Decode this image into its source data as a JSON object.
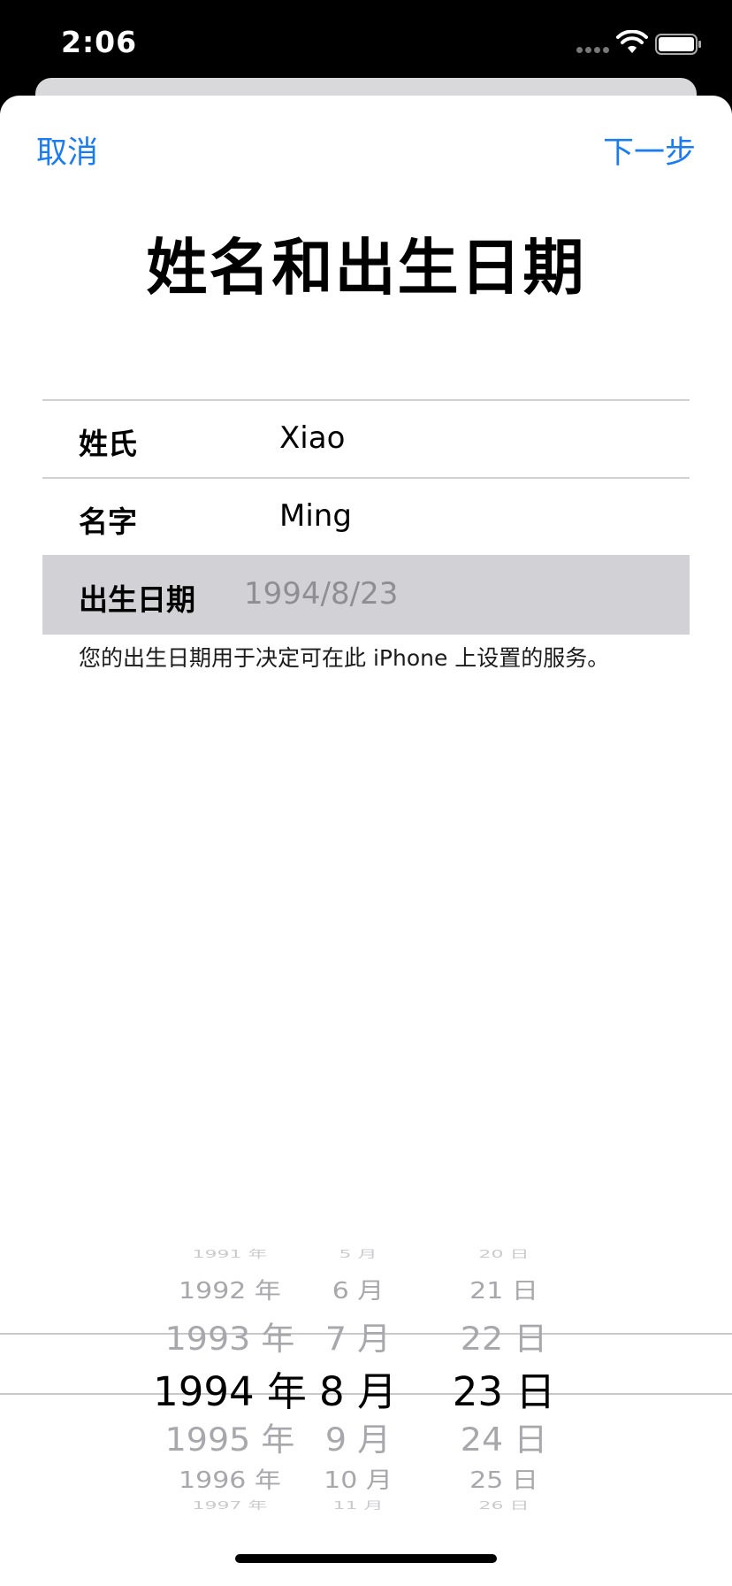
{
  "status_bar": {
    "time": "2:06"
  },
  "nav": {
    "cancel_label": "取消",
    "next_label": "下一步"
  },
  "title": "姓名和出生日期",
  "form": {
    "rows": [
      {
        "label": "姓氏",
        "value": "Xiao"
      },
      {
        "label": "名字",
        "value": "Ming"
      },
      {
        "label": "出生日期",
        "value": "1994/8/23"
      }
    ],
    "footnote": "您的出生日期用于决定可在此 iPhone 上设置的服务。"
  },
  "picker": {
    "years": [
      "1991 年",
      "1992 年",
      "1993 年",
      "1994 年",
      "1995 年",
      "1996 年",
      "1997 年"
    ],
    "months": [
      "5 月",
      "6 月",
      "7 月",
      "8 月",
      "9 月",
      "10 月",
      "11 月"
    ],
    "days": [
      "20 日",
      "21 日",
      "22 日",
      "23 日",
      "24 日",
      "25 日",
      "26 日"
    ],
    "selected_index": 3
  },
  "colors": {
    "accent": "#1a7cf1",
    "selected_row": "#d1d1d6"
  }
}
